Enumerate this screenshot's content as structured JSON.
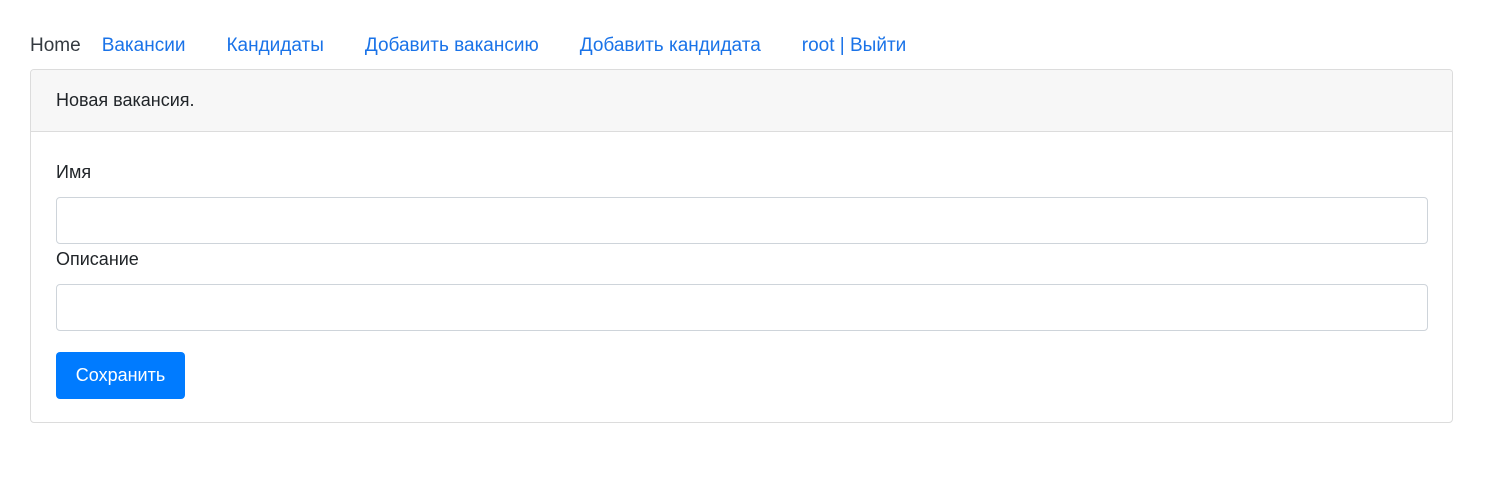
{
  "nav": {
    "brand": "Home",
    "links": [
      "Вакансии",
      "Кандидаты",
      "Добавить вакансию",
      "Добавить кандидата",
      "root | Выйти"
    ]
  },
  "card": {
    "header": "Новая вакансия.",
    "fields": [
      {
        "label": "Имя",
        "value": ""
      },
      {
        "label": "Описание",
        "value": ""
      }
    ],
    "save_label": "Сохранить"
  },
  "colors": {
    "link": "#1a73e8",
    "primary_button": "#007bff",
    "card_header_bg": "#f7f7f7"
  }
}
